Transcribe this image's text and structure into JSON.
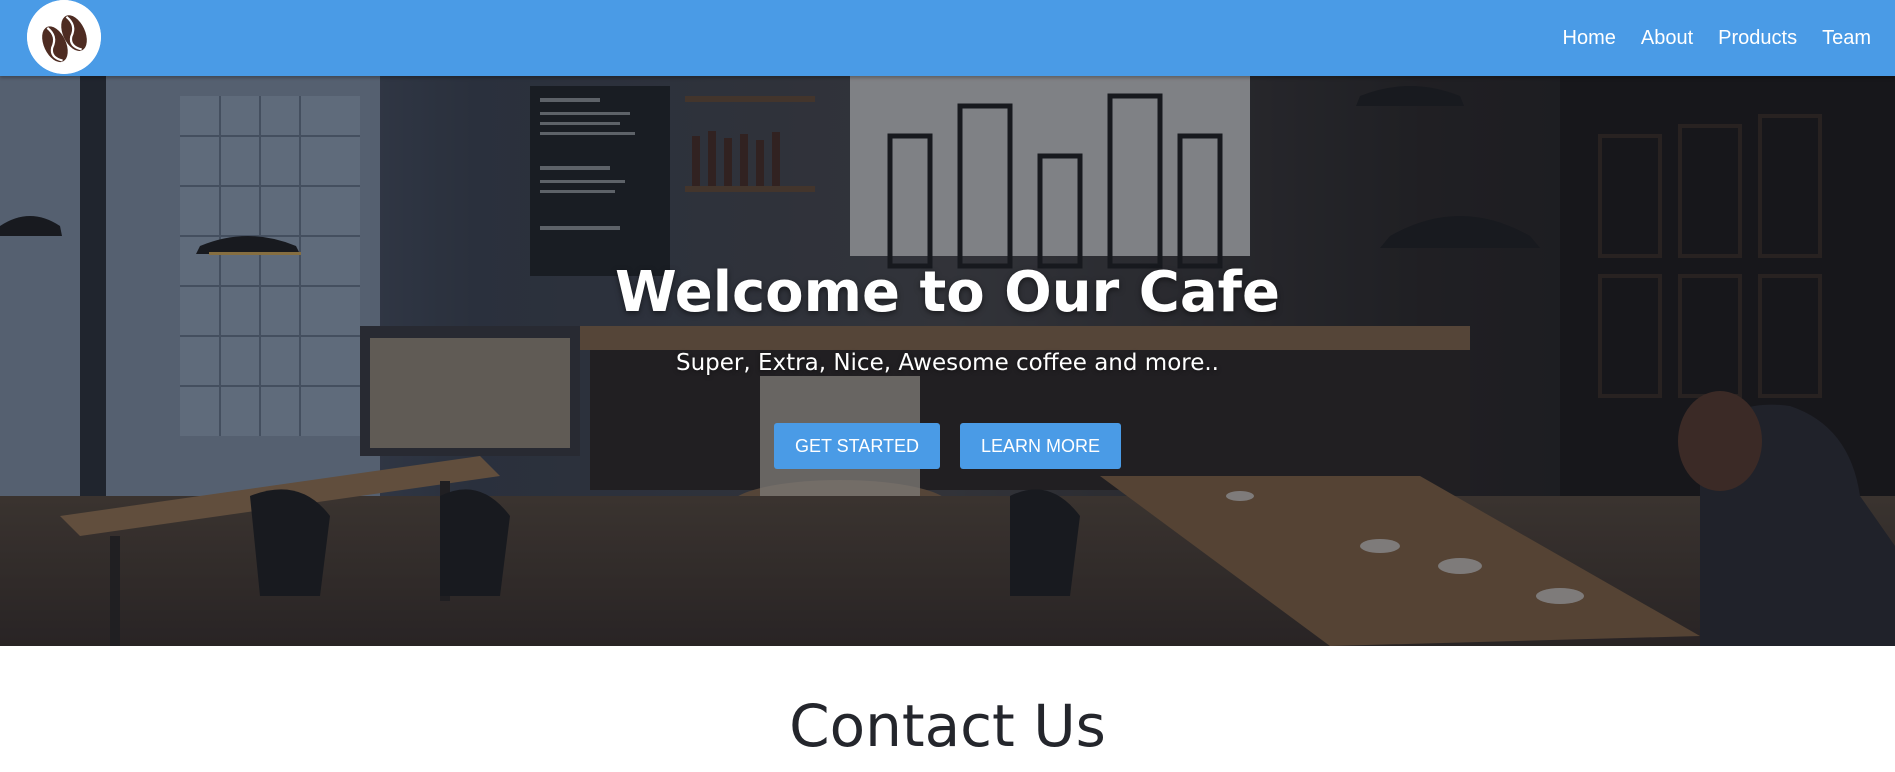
{
  "nav": {
    "logo_icon": "coffee-bean-icon",
    "links": [
      "Home",
      "About",
      "Products",
      "Team"
    ]
  },
  "hero": {
    "title": "Welcome to Our Cafe",
    "subtitle": "Super, Extra, Nice, Awesome coffee and more..",
    "buttons": [
      "GET STARTED",
      "LEARN MORE"
    ],
    "background_image": "cafe-interior-photo"
  },
  "contact": {
    "title": "Contact Us"
  },
  "colors": {
    "accent": "#4a9be6",
    "overlay": "#141824",
    "heading": "#24262c"
  }
}
